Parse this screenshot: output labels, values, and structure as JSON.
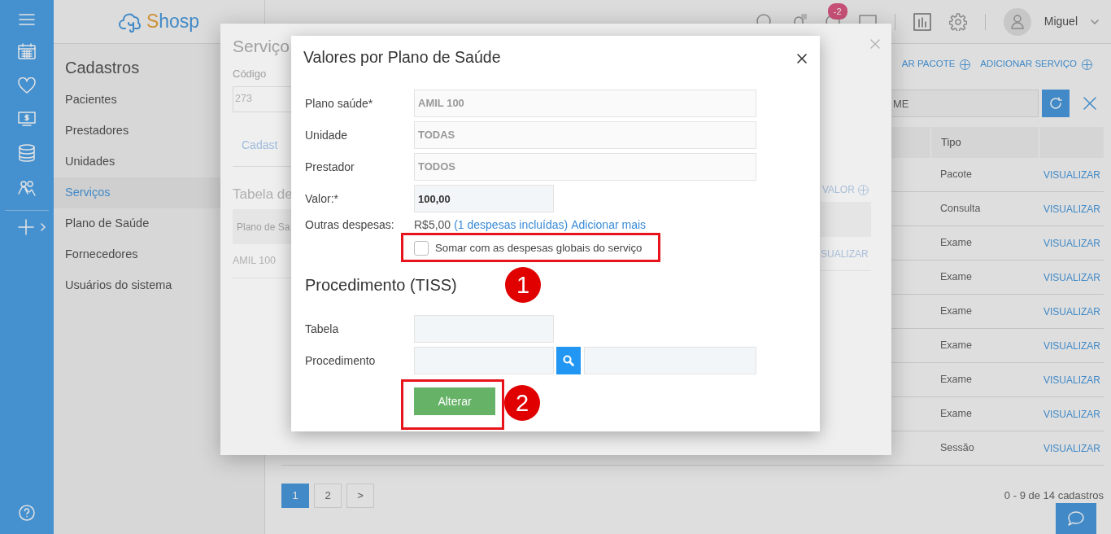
{
  "topbar": {
    "logo": "Shosp",
    "badge": "-2",
    "user": "Miguel"
  },
  "nav": {
    "title": "Cadastros",
    "items": [
      {
        "label": "Pacientes",
        "selected": false
      },
      {
        "label": "Prestadores",
        "selected": false
      },
      {
        "label": "Unidades",
        "selected": false
      },
      {
        "label": "Serviços",
        "selected": true
      },
      {
        "label": "Plano de Saúde",
        "selected": false
      },
      {
        "label": "Fornecedores",
        "selected": false
      },
      {
        "label": "Usuários do sistema",
        "selected": false
      }
    ]
  },
  "actions": [
    "AR PACOTE",
    "ADICIONAR SERVIÇO"
  ],
  "search": {
    "placeholder": "ME"
  },
  "table": {
    "columns": [
      "Tipo"
    ],
    "rows": [
      {
        "tipo": "Pacote",
        "action": "VISUALIZAR"
      },
      {
        "tipo": "Consulta",
        "action": "VISUALIZAR"
      },
      {
        "tipo": "Exame",
        "action": "VISUALIZAR"
      },
      {
        "tipo": "Exame",
        "action": "VISUALIZAR"
      },
      {
        "tipo": "Exame",
        "action": "VISUALIZAR"
      },
      {
        "tipo": "Exame",
        "action": "VISUALIZAR"
      },
      {
        "tipo": "Exame",
        "action": "VISUALIZAR"
      },
      {
        "tipo": "Exame",
        "action": "VISUALIZAR"
      },
      {
        "tipo": "Sessão",
        "action": "VISUALIZAR"
      }
    ]
  },
  "pagination": {
    "pages": [
      {
        "label": "1",
        "selected": true
      },
      {
        "label": "2",
        "selected": false
      },
      {
        "label": ">",
        "selected": false
      }
    ]
  },
  "count": "0 - 9 de 14 cadastros",
  "service_modal": {
    "title": "Serviço",
    "code_label": "Código",
    "code_value": "273",
    "tab": "Cadast",
    "section": "Tabela de",
    "column": "Plano de Sa",
    "row": "AMIL 100",
    "add": "VALOR",
    "row_action": "SUALIZAR"
  },
  "dialog": {
    "title": "Valores por Plano de Saúde",
    "fields": [
      {
        "kind": "select",
        "label": "Plano saúde*",
        "value": "AMIL 100",
        "disabled": true
      },
      {
        "kind": "select",
        "label": "Unidade",
        "value": "TODAS",
        "disabled": true
      },
      {
        "kind": "select",
        "label": "Prestador",
        "value": "TODOS",
        "disabled": true
      },
      {
        "kind": "input",
        "label": "Valor:*",
        "value": "100,00"
      }
    ],
    "expenses": {
      "label": "Outras despesas:",
      "amount": "R$5,00",
      "included_link": "(1 despesas incluídas)",
      "add_link": "Adicionar mais"
    },
    "sum_checkbox": {
      "label": "Somar com as despesas globais do serviço",
      "checked": false
    },
    "tiss": {
      "title": "Procedimento (TISS)",
      "table_label": "Tabela",
      "procedure_label": "Procedimento"
    },
    "submit": "Alterar"
  },
  "annotations": [
    {
      "number": "1"
    },
    {
      "number": "2"
    }
  ]
}
